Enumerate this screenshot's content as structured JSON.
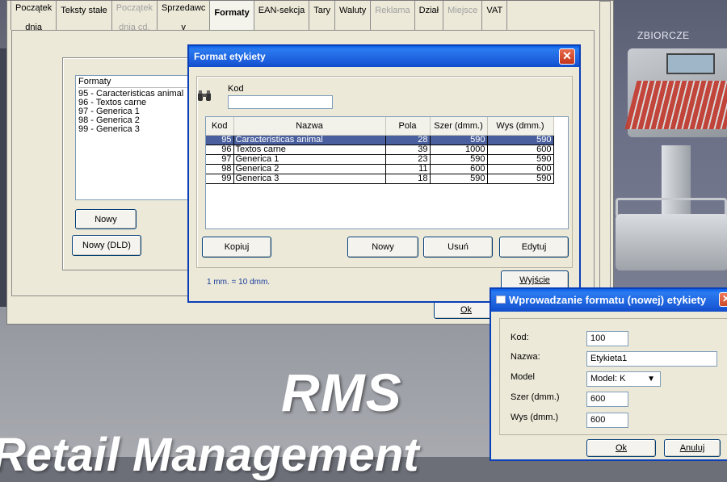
{
  "main_tabs": [
    {
      "l1": "Początek",
      "l2": "dnia",
      "state": "normal"
    },
    {
      "l1": "Teksty stałe",
      "l2": "",
      "state": "normal"
    },
    {
      "l1": "Początek",
      "l2": "dnia cd.",
      "state": "disabled"
    },
    {
      "l1": "Sprzedawc",
      "l2": "y",
      "state": "normal"
    },
    {
      "l1": "Formaty",
      "l2": "",
      "state": "active"
    },
    {
      "l1": "EAN-sekcja",
      "l2": "",
      "state": "normal"
    },
    {
      "l1": "Tary",
      "l2": "",
      "state": "normal"
    },
    {
      "l1": "Waluty",
      "l2": "",
      "state": "normal"
    },
    {
      "l1": "Reklama",
      "l2": "",
      "state": "disabled"
    },
    {
      "l1": "Dział",
      "l2": "",
      "state": "normal"
    },
    {
      "l1": "Miejsce",
      "l2": "",
      "state": "disabled"
    },
    {
      "l1": "VAT",
      "l2": "",
      "state": "normal"
    }
  ],
  "formats_panel": {
    "label": "Formaty",
    "items": [
      "95 - Caracteristicas animal",
      "96 - Textos carne",
      "97 - Generica 1",
      "98 - Generica 2",
      "99 - Generica 3"
    ],
    "new_button": "Nowy",
    "new_dld_button": "Nowy (DLD)"
  },
  "main_ok_button": "Ok",
  "format_dialog": {
    "title": "Format etykiety",
    "close": "✕",
    "kod_label": "Kod",
    "kod_value": "",
    "columns": [
      "Kod",
      "Nazwa",
      "Pola",
      "Szer (dmm.)",
      "Wys (dmm.)"
    ],
    "rows": [
      {
        "kod": "95",
        "nazwa": "Caracteristicas animal",
        "pola": "28",
        "szer": "590",
        "wys": "590"
      },
      {
        "kod": "96",
        "nazwa": "Textos carne",
        "pola": "39",
        "szer": "1000",
        "wys": "600"
      },
      {
        "kod": "97",
        "nazwa": "Generica 1",
        "pola": "23",
        "szer": "590",
        "wys": "590"
      },
      {
        "kod": "98",
        "nazwa": "Generica 2",
        "pola": "11",
        "szer": "600",
        "wys": "600"
      },
      {
        "kod": "99",
        "nazwa": "Generica 3",
        "pola": "18",
        "szer": "590",
        "wys": "590"
      }
    ],
    "selected_row": 0,
    "buttons": {
      "copy": "Kopiuj",
      "new": "Nowy",
      "delete": "Usuń",
      "edit": "Edytuj",
      "exit": "Wyjście"
    },
    "note": "1 mm. = 10 dmm."
  },
  "new_format_dialog": {
    "title": "Wprowadzanie formatu (nowej) etykiety",
    "fields": {
      "kod_label": "Kod:",
      "kod_value": "100",
      "nazwa_label": "Nazwa:",
      "nazwa_value": "Etykieta1",
      "model_label": "Model",
      "model_value": "Model: K",
      "szer_label": "Szer (dmm.)",
      "szer_value": "600",
      "wys_label": "Wys (dmm.)",
      "wys_value": "600"
    },
    "ok_button": "Ok",
    "cancel_button": "Anuluj"
  },
  "background": {
    "scale_label": "ZBIORCZE",
    "logo": "RMS",
    "tagline": "Retail Management"
  },
  "colors": {
    "title_bar": "#1a5ad8",
    "selection": "#4a5f9e",
    "close_button": "#c3341a"
  }
}
